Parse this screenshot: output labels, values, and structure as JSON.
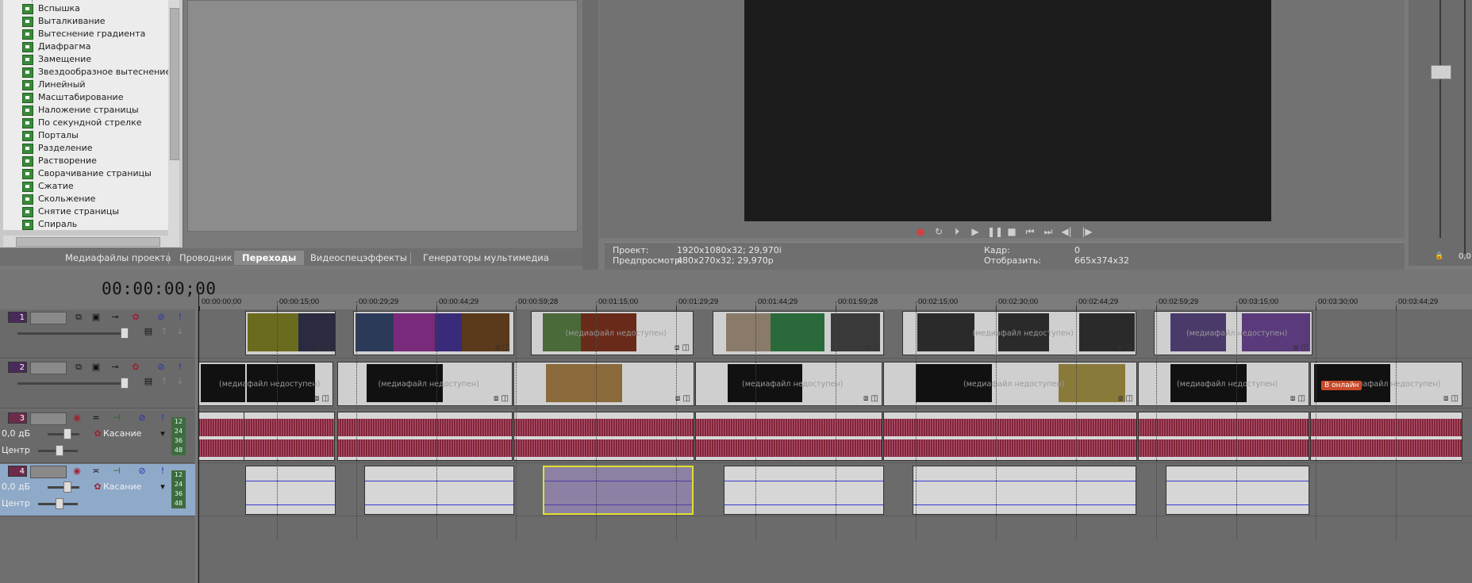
{
  "transitions": {
    "items": [
      "Вспышка",
      "Выталкивание",
      "Вытеснение градиента",
      "Диафрагма",
      "Замещение",
      "Звездообразное вытеснение",
      "Линейный",
      "Масштабирование",
      "Наложение страницы",
      "По секундной стрелке",
      "Порталы",
      "Разделение",
      "Растворение",
      "Сворачивание страницы",
      "Сжатие",
      "Скольжение",
      "Снятие страницы",
      "Спираль"
    ]
  },
  "tabs": [
    {
      "label": "Медиафайлы проекта",
      "active": false
    },
    {
      "label": "Проводник",
      "active": false
    },
    {
      "label": "Переходы",
      "active": true
    },
    {
      "label": "Видеоспецэффекты",
      "active": false
    },
    {
      "label": "Генераторы мультимедиа",
      "active": false
    }
  ],
  "preview_info": {
    "project_label": "Проект:",
    "project_value": "1920x1080x32; 29,970i",
    "preview_label": "Предпросмотр:",
    "preview_value": "480x270x32; 29,970p",
    "frame_label": "Кадр:",
    "frame_value": "0",
    "display_label": "Отобразить:",
    "display_value": "665x374x32"
  },
  "mixer": {
    "value": "0,0"
  },
  "timeline": {
    "timecode": "00:00:00;00",
    "ruler_labels": [
      "00:00:00;00",
      "00:00:15;00",
      "00:00:29;29",
      "00:00:44;29",
      "00:00:59;28",
      "00:01:15;00",
      "00:01:29;29",
      "00:01:44;29",
      "00:01:59;28",
      "00:02:15;00",
      "00:02:30;00",
      "00:02:44;29",
      "00:02:59;29",
      "00:03:15;00",
      "00:03:30;00",
      "00:03:44;29"
    ],
    "offline_text": "(медиафайл недоступен)",
    "offline_short": "(медиафайл",
    "go_online": "В онлайн"
  },
  "tracks": [
    {
      "num": "1",
      "type": "video"
    },
    {
      "num": "2",
      "type": "video"
    },
    {
      "num": "3",
      "type": "audio",
      "volume": "0,0 дБ",
      "mode": "Касание",
      "pan": "Центр",
      "meter": [
        "12",
        "24",
        "36",
        "48"
      ]
    },
    {
      "num": "4",
      "type": "audio",
      "volume": "0,0 дБ",
      "mode": "Касание",
      "pan": "Центр",
      "meter": [
        "12",
        "24",
        "36",
        "48"
      ]
    }
  ]
}
